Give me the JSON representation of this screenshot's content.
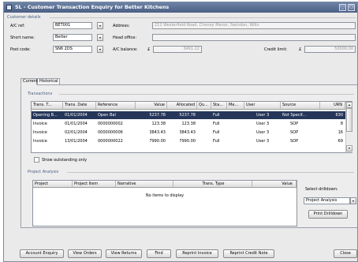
{
  "window": {
    "title": "SL - Customer Transaction Enquiry for Better Kitchens",
    "minimize": "_",
    "maximize": "□",
    "close": "×"
  },
  "details": {
    "group_label": "Customer details",
    "ac_ref_label": "A/C ref:",
    "ac_ref_value": "BET001",
    "short_name_label": "Short name:",
    "short_name_value": "Better",
    "post_code_label": "Post code:",
    "post_code_value": "SN6 2DS",
    "address_label": "Address:",
    "address_value": "212 Westerfield Road, Cheney Manor, Swindon, Wilts",
    "head_office_label": "Head office:",
    "head_office_value": "",
    "ac_balance_label": "A/C balance:",
    "currency": "£",
    "ac_balance_value": "3491.22",
    "credit_limit_label": "Credit limit:",
    "credit_limit_value": "50000.00"
  },
  "tabs": [
    "Current",
    "Historical"
  ],
  "transactions": {
    "group_label": "Transactions",
    "columns": [
      "Trans. T...",
      "Trans. Date",
      "Reference",
      "Value",
      "Allocated",
      "Qu...",
      "Sta...",
      "Me...",
      "User",
      "Source",
      "URN"
    ],
    "rows": [
      [
        "Opening B...",
        "01/01/2004",
        "Open Bal",
        "5237.78",
        "5237.78",
        "",
        "Full",
        "",
        "User 3",
        "Not Specif...",
        "630"
      ],
      [
        "Invoice",
        "01/01/2004",
        "0000000002",
        "123.38",
        "123.38",
        "",
        "Full",
        "",
        "User 3",
        "SOP",
        "8"
      ],
      [
        "Invoice",
        "02/01/2004",
        "0000000006",
        "3843.43",
        "3843.43",
        "",
        "Full",
        "",
        "User 3",
        "SOP",
        "16"
      ],
      [
        "Invoice",
        "13/01/2004",
        "0000000022",
        "7990.00",
        "7990.00",
        "",
        "Full",
        "",
        "User 3",
        "SOP",
        "69"
      ]
    ],
    "show_outstanding_label": "Show outstanding only"
  },
  "project_analysis": {
    "group_label": "Project Analysis",
    "columns": [
      "Project",
      "Project Item",
      "Narrative",
      "Trans. Type",
      "Value"
    ],
    "empty_text": "No items to display",
    "drilldown_label": "Select drilldown:",
    "drilldown_value": "Project Analysis",
    "print_drilldown": "Print Drilldown"
  },
  "buttons": {
    "account_enquiry": "Account Enquiry",
    "view_orders": "View Orders",
    "view_returns": "View Returns",
    "find": "Find",
    "reprint_invoice": "Reprint Invoice",
    "reprint_credit_note": "Reprint Credit Note",
    "close": "Close"
  }
}
